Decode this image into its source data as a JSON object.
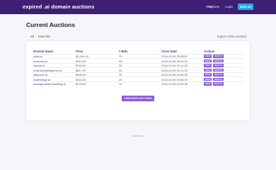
{
  "header": {
    "brand": "expired .ai domain auctions",
    "nav": [
      "FAQ",
      "Auctions",
      "Login"
    ],
    "signup_label": "SIGN UP"
  },
  "main": {
    "title": "Current Auctions",
    "tabs": [
      "All",
      "Watchlist"
    ],
    "export_label": "Export Active Auctions",
    "columns": [
      "Domain Name",
      "Price",
      "# Bids",
      "Close Date",
      "Actions"
    ],
    "rows": [
      {
        "domain": "volta.ai",
        "price": "$3,900.00",
        "bids": "73",
        "close": "2024-02-05 20:08:57"
      },
      {
        "domain": "maximus.ai",
        "price": "$912.00",
        "bids": "53",
        "close": "2024-02-05 20:22:42"
      },
      {
        "domain": "worlds.ai",
        "price": "$718.00",
        "bids": "35",
        "close": "2024-02-05 20:14:21"
      },
      {
        "domain": "businessintelligence.ai",
        "price": "$617.00",
        "bids": "30",
        "close": "2024-02-05 20:11:03"
      },
      {
        "domain": "satsocho.ai",
        "price": "$499.00",
        "bids": "40",
        "close": "2024-02-05 19:59:03"
      },
      {
        "domain": "multimerge.ai",
        "price": "$416.00",
        "bids": "20",
        "close": "2024-02-05 19:56:19"
      },
      {
        "domain": "managementconsulting.ai",
        "price": "$378.00",
        "bids": "13",
        "close": "2024-02-05 20:00:39"
      }
    ],
    "view_label": "VIEW",
    "watch_label": "WATCH",
    "past_auctions_label": "VIEW PAST AUCTIONS"
  },
  "footer": {
    "label": "Auctions"
  },
  "colors": {
    "header_bg": "#3d1f73",
    "accent": "#8b5cd6",
    "signup": "#27aae1"
  }
}
